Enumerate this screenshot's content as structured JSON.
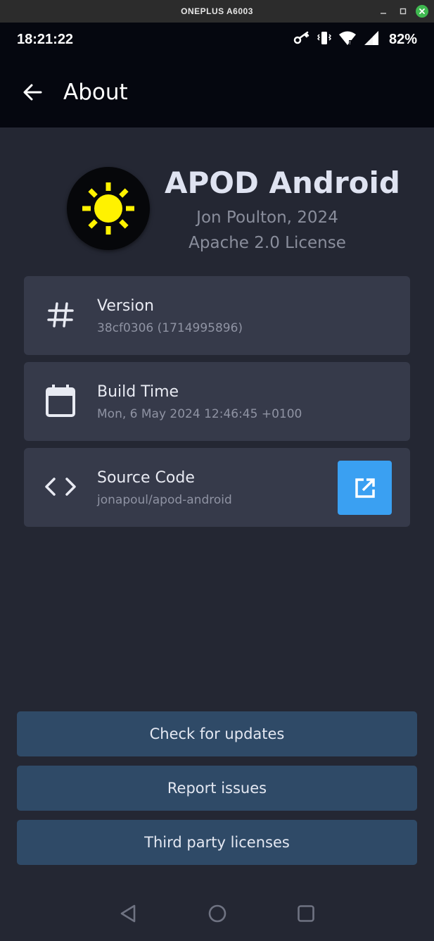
{
  "window": {
    "title": "ONEPLUS A6003"
  },
  "status_bar": {
    "time": "18:21:22",
    "battery": "82%"
  },
  "app_bar": {
    "title": "About"
  },
  "header": {
    "app_name": "APOD Android",
    "author": "Jon Poulton, 2024",
    "license": "Apache 2.0 License"
  },
  "cards": [
    {
      "title": "Version",
      "subtitle": "38cf0306 (1714995896)",
      "icon": "hash-icon"
    },
    {
      "title": "Build Time",
      "subtitle": "Mon, 6 May 2024 12:46:45 +0100",
      "icon": "calendar-icon"
    },
    {
      "title": "Source Code",
      "subtitle": "jonapoul/apod-android",
      "icon": "code-icon",
      "action_icon": "open-external-icon"
    }
  ],
  "actions": {
    "check_updates": "Check for updates",
    "report_issues": "Report issues",
    "licenses": "Third party licenses"
  },
  "colors": {
    "background": "#242733",
    "top_bar": "#05070f",
    "card": "#363a4a",
    "accent": "#3aa0f2",
    "action_button": "#2f4a67",
    "sun": "#fff200"
  }
}
